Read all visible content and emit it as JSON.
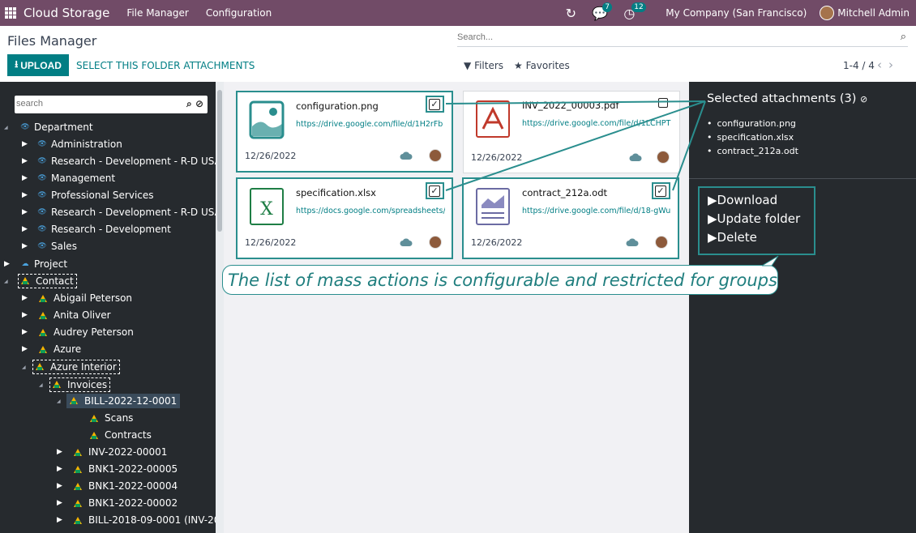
{
  "navbar": {
    "brand": "Cloud Storage",
    "menu": [
      "File Manager",
      "Configuration"
    ],
    "messages_count": "7",
    "activities_count": "12",
    "company": "My Company (San Francisco)",
    "user": "Mitchell Admin"
  },
  "control_panel": {
    "title": "Files Manager",
    "search_placeholder": "Search...",
    "upload_label": "UPLOAD",
    "select_folder_label": "SELECT THIS FOLDER ATTACHMENTS",
    "filters_label": "Filters",
    "favorites_label": "Favorites",
    "pager": "1-4 / 4"
  },
  "sidebar": {
    "search_placeholder": "search",
    "tree": [
      {
        "label": "Department"
      },
      {
        "label": "Administration"
      },
      {
        "label": "Research - Development - R-D USA - Lor"
      },
      {
        "label": "Management"
      },
      {
        "label": "Professional Services"
      },
      {
        "label": "Research - Development - R-D USA"
      },
      {
        "label": "Research - Development"
      },
      {
        "label": "Sales"
      },
      {
        "label": "Project"
      },
      {
        "label": "Contact"
      },
      {
        "label": "Abigail Peterson"
      },
      {
        "label": "Anita Oliver"
      },
      {
        "label": "Audrey Peterson"
      },
      {
        "label": "Azure"
      },
      {
        "label": "Azure Interior"
      },
      {
        "label": "Invoices"
      },
      {
        "label": "BILL-2022-12-0001"
      },
      {
        "label": "Scans"
      },
      {
        "label": "Contracts"
      },
      {
        "label": "INV-2022-00001"
      },
      {
        "label": "BNK1-2022-00005"
      },
      {
        "label": "BNK1-2022-00004"
      },
      {
        "label": "BNK1-2022-00002"
      },
      {
        "label": "BILL-2018-09-0001 (INV-2018-0"
      }
    ]
  },
  "cards": [
    {
      "name": "configuration.png",
      "url": "https://drive.google.com/file/d/1H2rFb",
      "date": "12/26/2022",
      "selected": true
    },
    {
      "name": "INV_2022_00003.pdf",
      "url": "https://drive.google.com/file/d/1LCHPT",
      "date": "12/26/2022",
      "selected": false
    },
    {
      "name": "specification.xlsx",
      "url": "https://docs.google.com/spreadsheets/",
      "date": "12/26/2022",
      "selected": true
    },
    {
      "name": "contract_212a.odt",
      "url": "https://drive.google.com/file/d/18-gWu",
      "date": "12/26/2022",
      "selected": true
    }
  ],
  "selection": {
    "title": "Selected attachments (3)",
    "items": [
      "configuration.png",
      "specification.xlsx",
      "contract_212a.odt"
    ],
    "actions": [
      "Download",
      "Update folder",
      "Delete"
    ]
  },
  "callout": "The list of mass actions is configurable and restricted for groups",
  "colors": {
    "navbar": "#714B67",
    "accent": "#017e84",
    "annotation": "#2a8e8e"
  }
}
